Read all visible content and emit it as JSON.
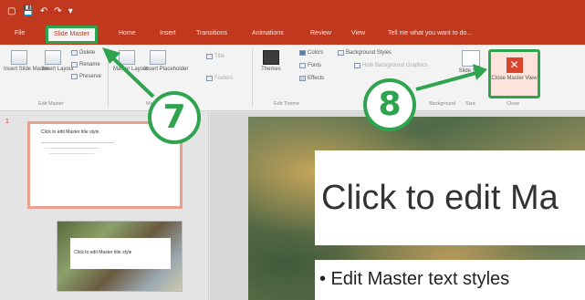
{
  "window": {
    "quick_access": [
      "▢",
      "💾",
      "↶",
      "↷",
      "▾"
    ]
  },
  "ribbon_tabs": [
    {
      "label": "File",
      "active": false
    },
    {
      "label": "Slide Master",
      "active": true
    },
    {
      "label": "Home",
      "active": false
    },
    {
      "label": "Insert",
      "active": false
    },
    {
      "label": "Transitions",
      "active": false
    },
    {
      "label": "Animations",
      "active": false
    },
    {
      "label": "Review",
      "active": false
    },
    {
      "label": "View",
      "active": false
    },
    {
      "label": "Tell me what you want to do...",
      "active": false
    }
  ],
  "ribbon": {
    "insert_slide_master": "Insert Slide Master",
    "insert_layout": "Insert Layout",
    "delete": "Delete",
    "rename": "Rename",
    "preserve": "Preserve",
    "master_layout": "Master Layout",
    "insert_placeholder": "Insert Placeholder",
    "title": "Title",
    "footers": "Footers",
    "themes": "Themes",
    "colors": "Colors",
    "fonts": "Fonts",
    "effects": "Effects",
    "background_styles": "Background Styles",
    "hide_background_graphics": "Hide Background Graphics",
    "slide_size": "Slide Size",
    "close_master_view": "Close Master View",
    "groups": {
      "edit_master": "Edit Master",
      "master_layout": "Master Layout",
      "edit_theme": "Edit Theme",
      "background": "Background",
      "size": "Size",
      "close": "Close"
    }
  },
  "callouts": {
    "step7": "7",
    "step8": "8"
  },
  "thumbnails": {
    "slide1_number": "1",
    "slide1_title": "Click to edit Master title style",
    "slide2_title": "Click to edit Master title style"
  },
  "slide": {
    "title": "Click to edit Ma",
    "body": "• Edit Master text styles"
  },
  "colors": {
    "accent": "#c0391f",
    "highlight": "#2ea44f"
  }
}
